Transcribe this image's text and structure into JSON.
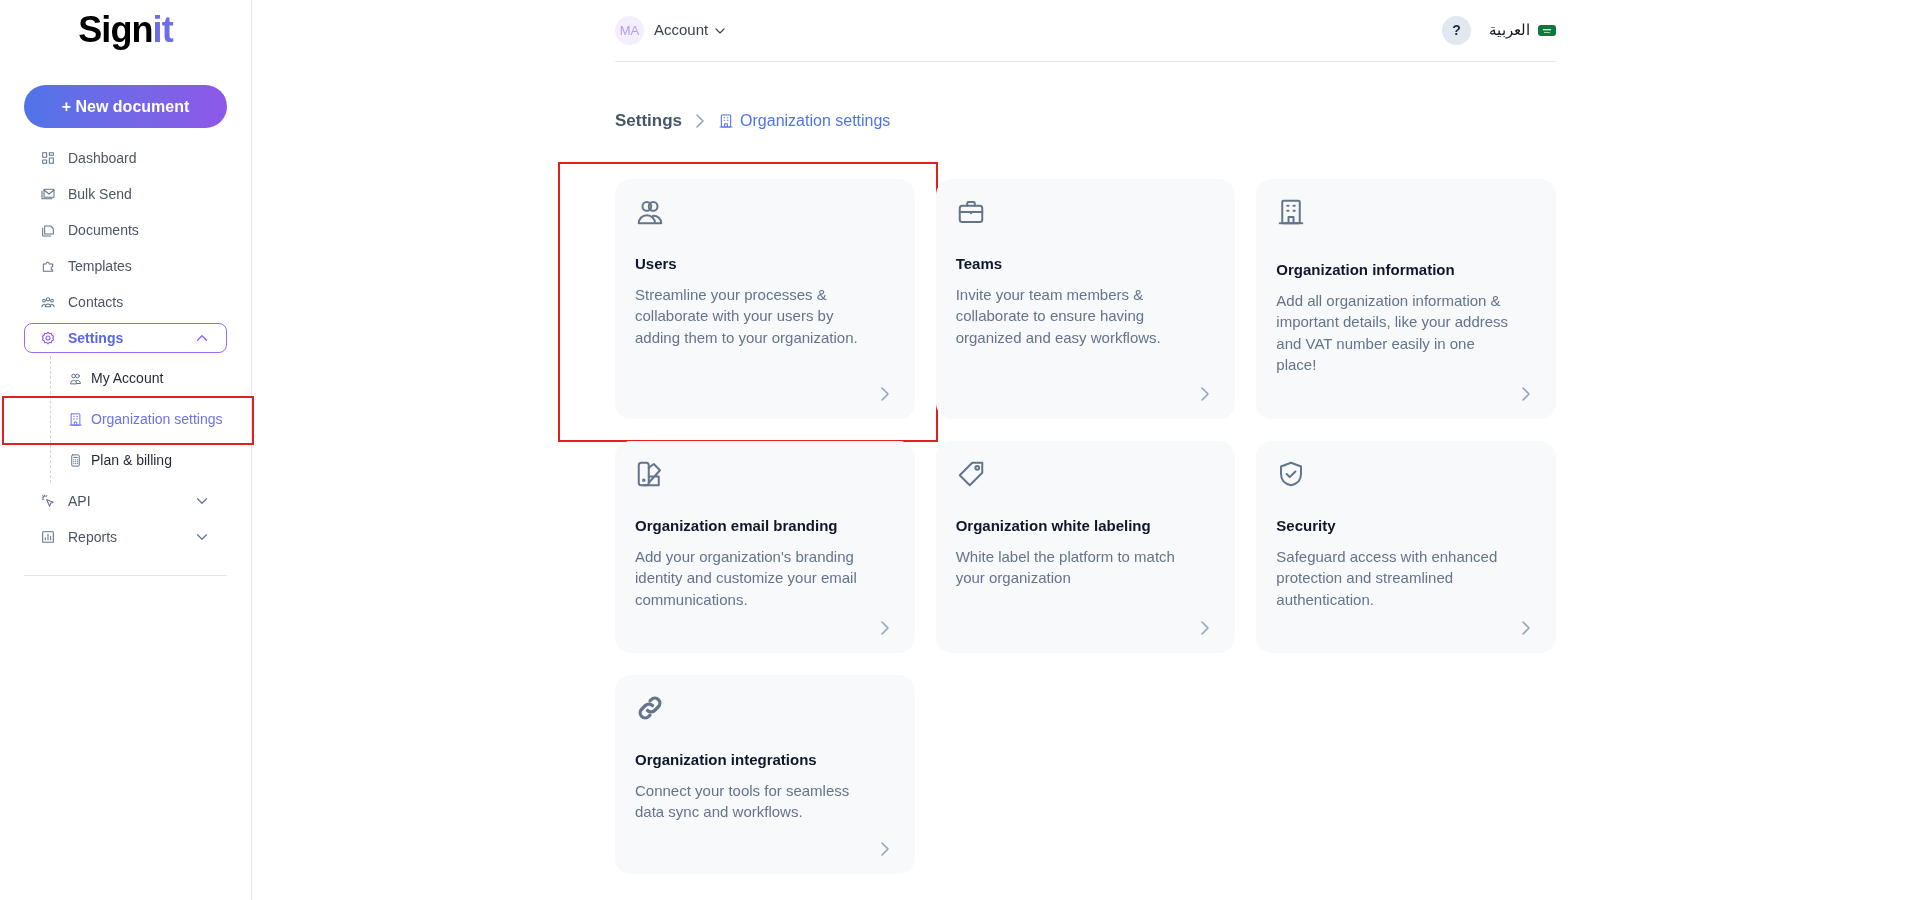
{
  "logo": {
    "text": "Sign",
    "accent": "it"
  },
  "new_button": "+ New document",
  "sidebar": {
    "items": [
      {
        "label": "Dashboard",
        "selected": false
      },
      {
        "label": "Bulk Send",
        "selected": false
      },
      {
        "label": "Documents",
        "selected": false
      },
      {
        "label": "Templates",
        "selected": false
      },
      {
        "label": "Contacts",
        "selected": false
      },
      {
        "label": "Settings",
        "selected": true,
        "expanded": true,
        "children": [
          {
            "label": "My Account",
            "selected": false,
            "highlighted": false
          },
          {
            "label": "Organization settings",
            "selected": true,
            "highlighted": true
          },
          {
            "label": "Plan & billing",
            "selected": false,
            "highlighted": false
          }
        ]
      },
      {
        "label": "API",
        "selected": false,
        "expanded": false
      },
      {
        "label": "Reports",
        "selected": false,
        "expanded": false
      }
    ]
  },
  "header": {
    "avatar": "MA",
    "account": "Account",
    "help": "?",
    "language": "العربية"
  },
  "breadcrumb": [
    {
      "label": "Settings",
      "current": false
    },
    {
      "label": "Organization settings",
      "current": true
    }
  ],
  "cards": [
    {
      "title": "Users",
      "description": "Streamline your processes & collaborate with your users by adding them to your organization.",
      "highlighted": true
    },
    {
      "title": "Teams",
      "description": "Invite your team members & collaborate to ensure having organized and easy workflows.",
      "highlighted": false
    },
    {
      "title": "Organization information",
      "description": "Add all organization information & important details, like your address and VAT number easily in one place!",
      "highlighted": false
    },
    {
      "title": "Organization email branding",
      "description": "Add your organization's branding identity and customize your email communications.",
      "highlighted": false
    },
    {
      "title": "Organization white labeling",
      "description": "White label the platform to match your organization",
      "highlighted": false
    },
    {
      "title": "Security",
      "description": "Safeguard access with enhanced protection and streamlined authentication.",
      "highlighted": false
    },
    {
      "title": "Organization integrations",
      "description": "Connect your tools for seamless data sync and workflows.",
      "highlighted": false
    }
  ]
}
